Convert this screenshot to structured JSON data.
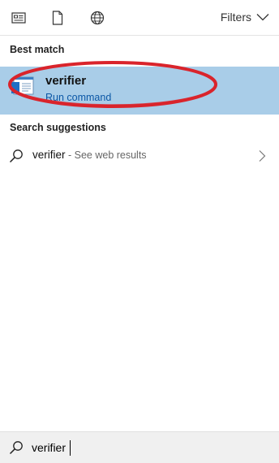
{
  "toolbar": {
    "icons": [
      "apps-icon",
      "documents-icon",
      "web-icon"
    ],
    "filters_label": "Filters"
  },
  "best_match": {
    "section_title": "Best match",
    "app_name": "verifier",
    "app_subtitle": "Run command"
  },
  "suggestions": {
    "section_title": "Search suggestions",
    "items": [
      {
        "query": "verifier",
        "hint": " - See web results"
      }
    ]
  },
  "search": {
    "value": "verifier"
  },
  "colors": {
    "selection_bg": "#a9cde8",
    "annotation_red": "#d9242c",
    "link_blue": "#0b57a6"
  }
}
